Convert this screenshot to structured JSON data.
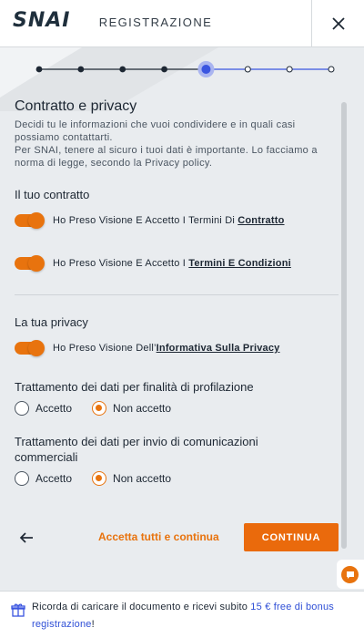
{
  "header": {
    "logo": "SNAI",
    "title": "REGISTRAZIONE"
  },
  "stepper": {
    "total_steps": 8,
    "current_step": 5
  },
  "contract_section": {
    "title": "Contratto e privacy",
    "intro_line1": "Decidi tu le informazioni che vuoi condividere e in quali casi",
    "intro_line2": "possiamo contattarti.",
    "intro_line3": "Per SNAI, tenere al sicuro i tuoi dati è importante. Lo facciamo a",
    "intro_line4": "norma di legge, secondo la Privacy policy."
  },
  "your_contract": {
    "title": "Il tuo contratto",
    "toggle1_prefix": "Ho Preso Visione E Accetto I Termini Di ",
    "toggle1_link": "Contratto",
    "toggle2_prefix": "Ho Preso Visione E Accetto I ",
    "toggle2_link": "Termini E Condizioni"
  },
  "your_privacy": {
    "title": "La tua privacy",
    "toggle_prefix": "Ho Preso Visione Dell’",
    "toggle_link": "Informativa Sulla Privacy"
  },
  "profiling": {
    "title": "Trattamento dei dati per finalità di profilazione",
    "option_accept": "Accetto",
    "option_decline": "Non accetto",
    "selected": "Non accetto"
  },
  "commercial": {
    "title": "Trattamento dei dati per invio di comunicazioni commerciali",
    "option_accept": "Accetto",
    "option_decline": "Non accetto",
    "selected": "Non accetto"
  },
  "actions": {
    "accept_all": "Accetta tutti e continua",
    "continue": "CONTINUA"
  },
  "banner": {
    "text_before": "Ricorda di caricare il documento e ricevi subito ",
    "highlight": "15 € free di bonus registrazione",
    "text_after": "!"
  },
  "colors": {
    "accent": "#e8730e",
    "stepper_active": "#3a55e0",
    "banner_link": "#2f4fd6"
  },
  "icons": {
    "close": "close-icon",
    "back": "arrow-left-icon",
    "chat": "chat-icon",
    "gift": "gift-icon"
  }
}
